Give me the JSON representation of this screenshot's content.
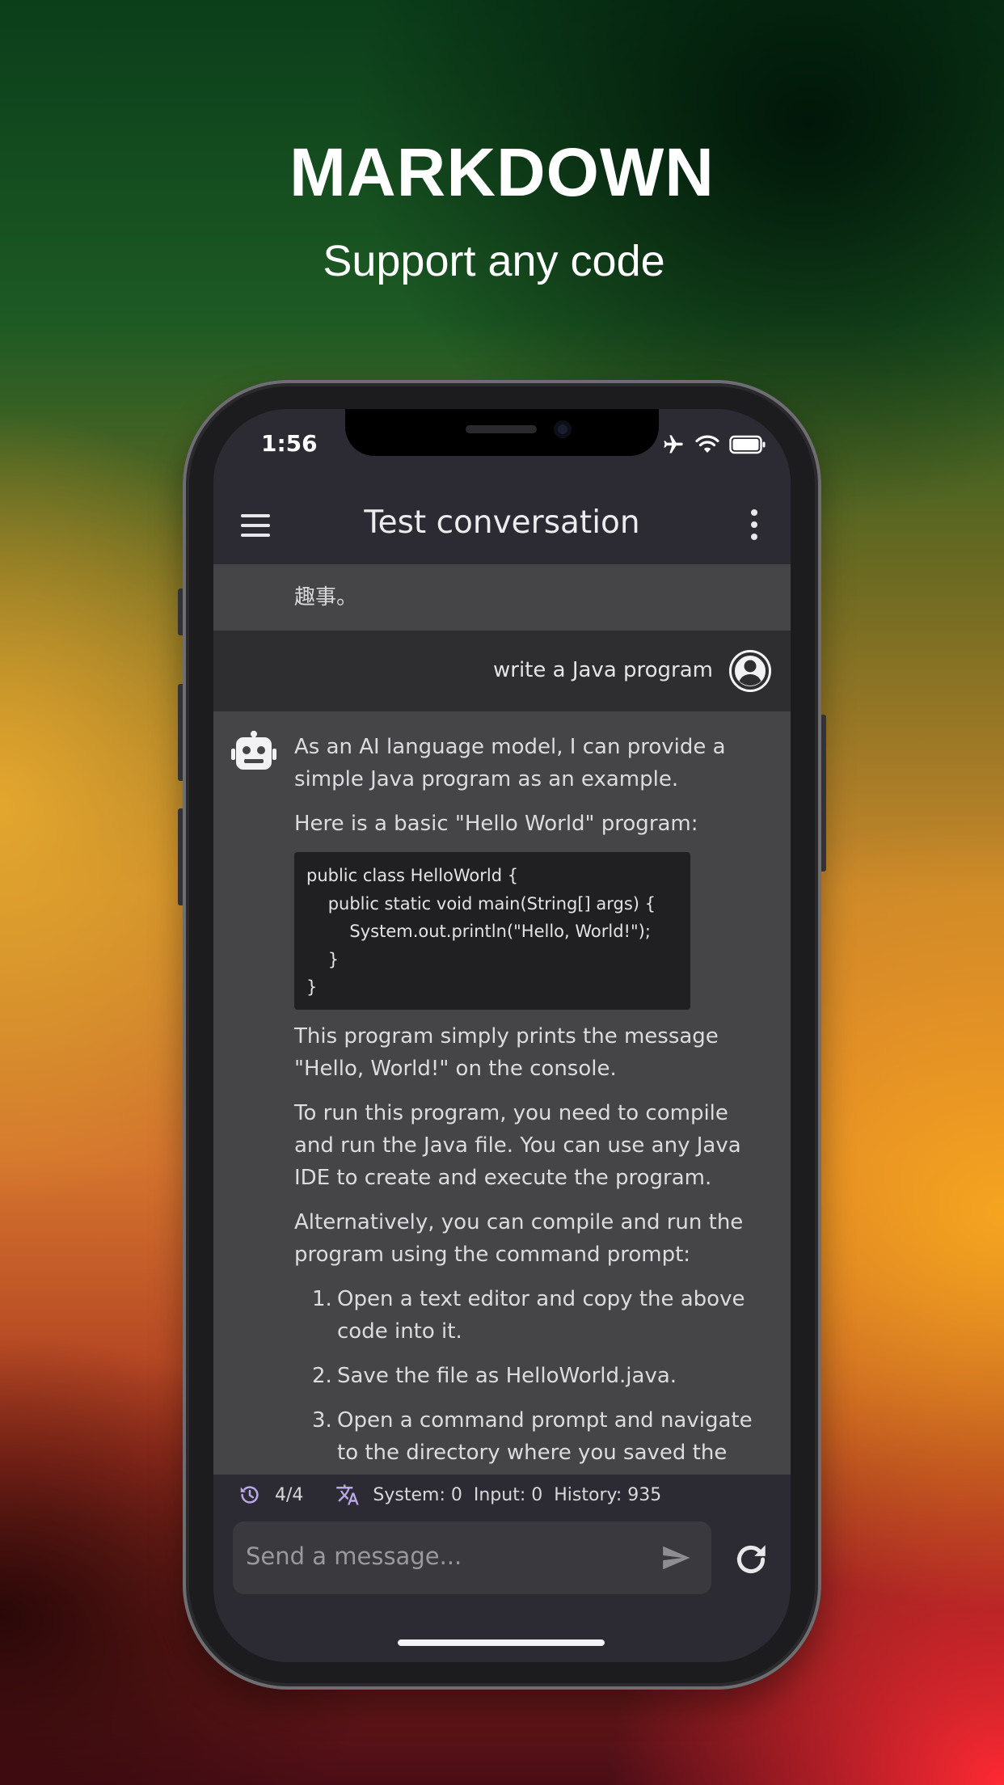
{
  "hero": {
    "title": "MARKDOWN",
    "subtitle": "Support any code"
  },
  "status_bar": {
    "time": "1:56",
    "icons": [
      "airplane-icon",
      "wifi-icon",
      "battery-icon"
    ]
  },
  "app_bar": {
    "title": "Test conversation",
    "menu_icon": "hamburger-menu-icon",
    "more_icon": "more-vertical-icon"
  },
  "messages": {
    "previous_partial_line1": "",
    "previous_partial_line2": "趣事。",
    "user_message": "write a Java program",
    "bot": {
      "intro": "As an AI language model, I can provide a simple Java program as an example.",
      "lead": "Here is a basic \"Hello World\" program:",
      "code_lines": [
        "public class HelloWorld {",
        "    public static void main(String[] args) {",
        "        System.out.println(\"Hello, World!\");",
        "    }",
        "}"
      ],
      "para1": "This program simply prints the message \"Hello, World!\" on the console.",
      "para2": "To run this program, you need to compile and run the Java file. You can use any Java IDE to create and execute the program.",
      "para3": "Alternatively, you can compile and run the program using the command prompt:",
      "steps": [
        {
          "num": "1.",
          "text": "Open a text editor and copy the above code into it."
        },
        {
          "num": "2.",
          "text": "Save the file as HelloWorld.java."
        },
        {
          "num": "3.",
          "text": "Open a command prompt and navigate to the directory where you saved the"
        }
      ]
    }
  },
  "stats": {
    "history_count": "4/4",
    "system": "System: 0",
    "input": "Input: 0",
    "history": "History: 935"
  },
  "composer": {
    "placeholder": "Send a message...",
    "send_icon": "send-icon",
    "refresh_icon": "refresh-icon"
  },
  "colors": {
    "screen_bg": "#2c2b33",
    "bot_bg": "#454548",
    "user_bg": "#2e2e30",
    "code_bg": "#202022",
    "accent_icon": "#b9a8e8"
  }
}
